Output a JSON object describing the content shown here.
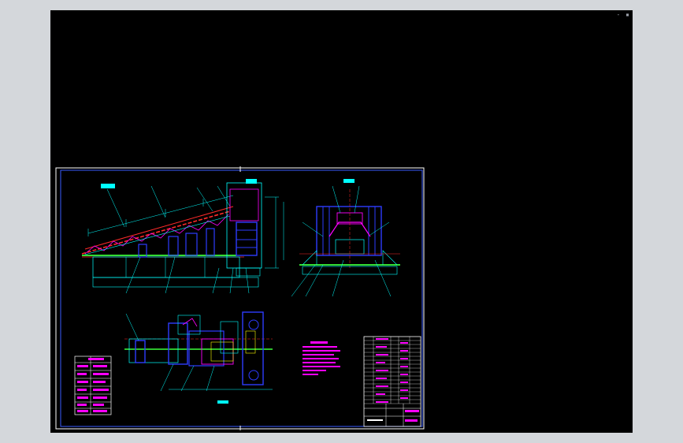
{
  "colors": {
    "frame": "#ffffff",
    "border": "#3a5bff",
    "cyan": "#00ffff",
    "red": "#ff2a2a",
    "magenta": "#ff00ff",
    "blue": "#2d3cff",
    "green": "#33dd33",
    "yellow": "#ffff00",
    "white": "#ffffff"
  },
  "icons": {
    "viewport_control": "viewport-control-icon"
  },
  "viewport": {
    "corner_marker": "- ▪"
  }
}
